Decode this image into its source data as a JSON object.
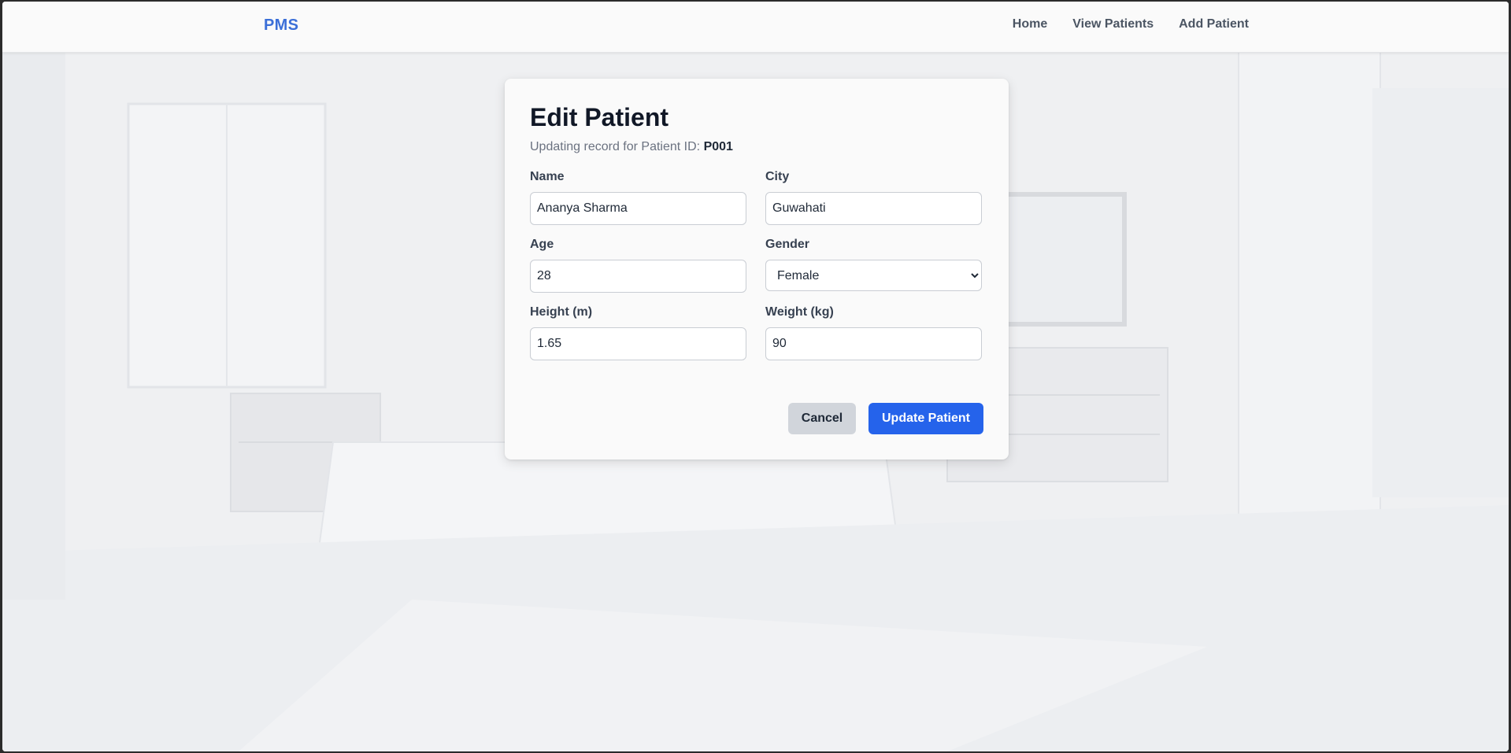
{
  "navbar": {
    "brand": "PMS",
    "links": [
      {
        "label": "Home"
      },
      {
        "label": "View Patients"
      },
      {
        "label": "Add Patient"
      }
    ]
  },
  "form": {
    "title": "Edit Patient",
    "subtitle_prefix": "Updating record for Patient ID: ",
    "patient_id": "P001",
    "fields": {
      "name": {
        "label": "Name",
        "value": "Ananya Sharma"
      },
      "city": {
        "label": "City",
        "value": "Guwahati"
      },
      "age": {
        "label": "Age",
        "value": "28"
      },
      "gender": {
        "label": "Gender",
        "value": "Female"
      },
      "height": {
        "label": "Height (m)",
        "value": "1.65"
      },
      "weight": {
        "label": "Weight (kg)",
        "value": "90"
      }
    },
    "cancel_label": "Cancel",
    "submit_label": "Update Patient"
  },
  "colors": {
    "brand": "#3b6fd8",
    "primary_button": "#2563eb",
    "cancel_button": "#d1d5db"
  }
}
